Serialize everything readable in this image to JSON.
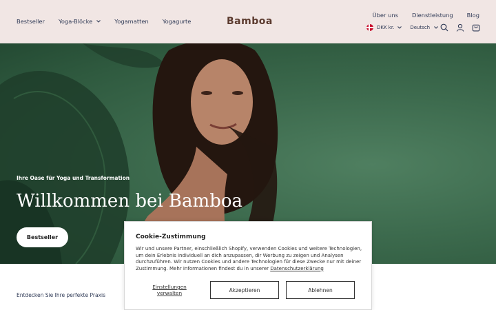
{
  "header": {
    "logo": "Bamboa",
    "nav_left": [
      {
        "label": "Bestseller"
      },
      {
        "label": "Yoga-Blöcke",
        "has_dropdown": true
      },
      {
        "label": "Yogamatten"
      },
      {
        "label": "Yogagurte"
      }
    ],
    "nav_right": [
      {
        "label": "Über uns"
      },
      {
        "label": "Dienstleistung"
      },
      {
        "label": "Blog"
      }
    ],
    "currency": "DKK kr.",
    "language": "Deutsch",
    "icons": [
      "search-icon",
      "account-icon",
      "cart-icon"
    ]
  },
  "hero": {
    "subtitle": "Ihre Oase für Yoga und Transformation",
    "title": "Willkommen bei Bamboa",
    "button_label": "Bestseller"
  },
  "section": {
    "discover": "Entdecken Sie Ihre perfekte Praxis"
  },
  "cookie": {
    "title": "Cookie-Zustimmung",
    "text": "Wir und unsere Partner, einschließlich Shopify, verwenden Cookies und weitere Technologien, um dein Erlebnis individuell an dich anzupassen, dir Werbung zu zeigen und Analysen durchzuführen. Wir nutzen Cookies und andere Technologien für diese Zwecke nur mit deiner Zustimmung. Mehr Informationen findest du in unserer",
    "privacy_link": "Datenschutzerklärung",
    "settings": "Einstellungen verwalten",
    "accept": "Akzeptieren",
    "decline": "Ablehnen"
  },
  "colors": {
    "header_bg": "#f1e6e4",
    "nav_text": "#2f3a56",
    "logo": "#5b3a2e",
    "hero_green": "#3d6b4e"
  }
}
